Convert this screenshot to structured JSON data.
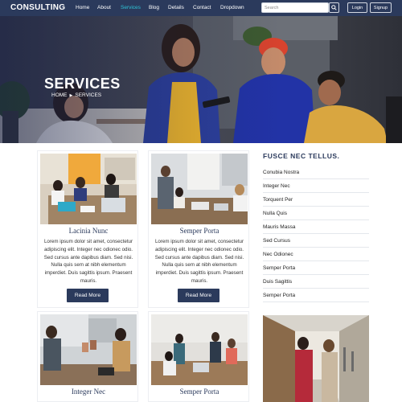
{
  "brand": "CONSULTING",
  "nav": {
    "items": [
      {
        "label": "Home"
      },
      {
        "label": "About"
      },
      {
        "label": "Services",
        "active": true
      },
      {
        "label": "Blog"
      },
      {
        "label": "Details"
      },
      {
        "label": "Contact"
      },
      {
        "label": "Dropdown"
      }
    ],
    "search_placeholder": "Search",
    "login_label": "Login",
    "signup_label": "Signup"
  },
  "hero": {
    "title": "SERVICES",
    "breadcrumb": {
      "home": "HOME",
      "current": "SERVICES"
    }
  },
  "cards": [
    {
      "title": "Lacinia Nunc",
      "text": "Lorem ipsum dolor sit amet, consectetur adipiscing elit. Integer nec odionec odio. Sed cursus ante dapibus diam. Sed nisi. Nulla quis sem at nibh elementum imperdiet. Duis sagittis ipsum. Praesent mauris.",
      "button": "Read More"
    },
    {
      "title": "Semper Porta",
      "text": "Lorem ipsum dolor sit amet, consectetur adipiscing elit. Integer nec odionec odio. Sed cursus ante dapibus diam. Sed nisi. Nulla quis sem at nibh elementum imperdiet. Duis sagittis ipsum. Praesent mauris.",
      "button": "Read More"
    },
    {
      "title": "Integer Nec"
    },
    {
      "title": "Semper Porta"
    }
  ],
  "sidebar": {
    "title": "FUSCE NEC TELLUS.",
    "items": [
      "Conubia Nostra",
      "Integer Nec",
      "Torquent Per",
      "Nulla Quis",
      "Mauris Massa",
      "Sed Cursus",
      "Nec Odionec",
      "Semper Porta",
      "Duis Sagittis",
      "Semper Porta"
    ]
  },
  "colors": {
    "navbar": "#2b3a5c",
    "active_link": "#2ec4d6",
    "button": "#2b3a5c",
    "heading": "#2b3a5c"
  },
  "icons": {
    "search": "search-icon",
    "breadcrumb_separator": "chevron-right-icon"
  }
}
